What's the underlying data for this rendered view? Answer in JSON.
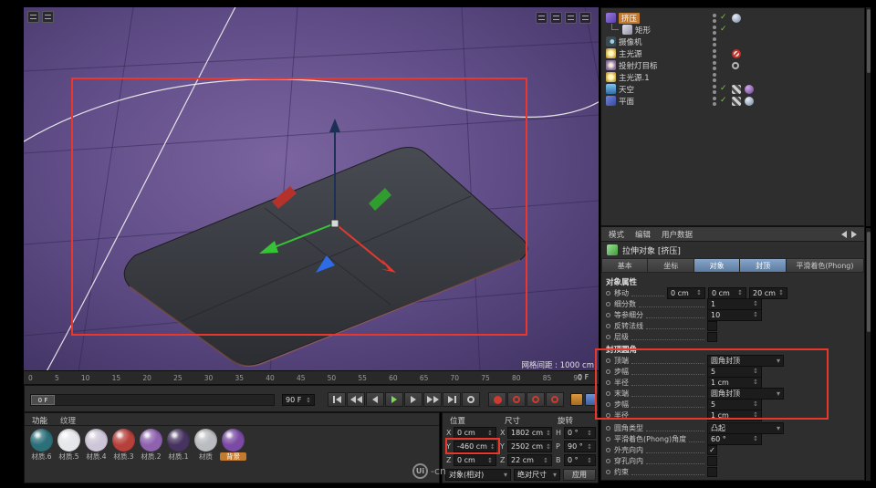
{
  "colors": {
    "annotation": "#e8372b",
    "selection_orange": "#c17a2f",
    "tab_blue": "#6b8cb0",
    "viewport_purple": "#64508a"
  },
  "viewport": {
    "grid_spacing_label": "网格间距 : 1000 cm"
  },
  "timeline": {
    "ticks": [
      "0",
      "5",
      "10",
      "15",
      "20",
      "25",
      "30",
      "35",
      "40",
      "45",
      "50",
      "55",
      "60",
      "65",
      "70",
      "75",
      "80",
      "85",
      "90"
    ],
    "range_start_handle": "0 F",
    "range_end_field": "90 F",
    "frame_indicator": "0 F"
  },
  "materials": {
    "tabs": [
      "功能",
      "纹理"
    ],
    "items": [
      {
        "name": "材质.6",
        "color": "#2b6f79"
      },
      {
        "name": "材质.5",
        "color": "#e6e7ea"
      },
      {
        "name": "材质.4",
        "color": "#cdc6d8"
      },
      {
        "name": "材质.3",
        "color": "#b8403a"
      },
      {
        "name": "材质.2",
        "color": "#8f62b0"
      },
      {
        "name": "材质.1",
        "color": "#46335f"
      },
      {
        "name": "材质",
        "color": "#b9bcc0"
      },
      {
        "name": "背景",
        "color": "#7a4aa4"
      }
    ]
  },
  "coordinates": {
    "columns": [
      "位置",
      "尺寸",
      "旋转"
    ],
    "rows": {
      "pos_x_label": "X",
      "pos_x": "0 cm",
      "pos_y_label": "Y",
      "pos_y": "-460 cm",
      "pos_z_label": "Z",
      "pos_z": "0 cm",
      "size_x_label": "X",
      "size_x": "1802 cm",
      "size_y_label": "Y",
      "size_y": "2502 cm",
      "size_z_label": "Z",
      "size_z": "22 cm",
      "rot_h_label": "H",
      "rot_h": "0 °",
      "rot_p_label": "P",
      "rot_p": "90 °",
      "rot_b_label": "B",
      "rot_b": "0 °"
    },
    "mode_dropdown": "对象(相对)",
    "size_dropdown": "绝对尺寸",
    "apply_button": "应用"
  },
  "object_manager": {
    "items": [
      {
        "name": "挤压",
        "check": "✓"
      },
      {
        "name": "矩形",
        "check": "✓"
      },
      {
        "name": "摄像机",
        "check": ""
      },
      {
        "name": "主光源",
        "check": ""
      },
      {
        "name": "投射灯目标",
        "check": ""
      },
      {
        "name": "主光源.1",
        "check": ""
      },
      {
        "name": "天空",
        "check": "✓"
      },
      {
        "name": "平面",
        "check": "✓"
      }
    ]
  },
  "attributes": {
    "menu": [
      "模式",
      "编辑",
      "用户数据"
    ],
    "title": "拉伸对象 [挤压]",
    "tabs": [
      "基本",
      "坐标",
      "对象",
      "封顶",
      "平滑着色(Phong)"
    ],
    "object_section": "对象属性",
    "rows": {
      "move_label": "移动",
      "move_x": "0 cm",
      "move_y": "0 cm",
      "move_z": "20 cm",
      "subdiv_label": "细分数",
      "subdiv": "1",
      "iso_label": "等参细分",
      "iso": "10",
      "flip_label": "反转法线",
      "flip_check": "",
      "hier_label": "层级",
      "hier_check": "",
      "caps_section": "封顶圆角",
      "start_label": "顶端",
      "start_value": "圆角封顶",
      "steps1_label": "步幅",
      "steps1": "5",
      "radius1_label": "半径",
      "radius1": "1 cm",
      "end_label": "末端",
      "end_value": "圆角封顶",
      "steps2_label": "步幅",
      "steps2": "5",
      "radius2_label": "半径",
      "radius2": "1 cm",
      "fillet_label": "圆角类型",
      "fillet_value": "凸起",
      "phong_label": "平滑着色(Phong)角度",
      "phong_value": "60 °",
      "hull_label": "外壳向内",
      "hull_check": "✓",
      "hole_label": "穿孔向内",
      "hole_check": "",
      "constrain_label": "约束",
      "constrain_check": ""
    }
  },
  "watermark": {
    "circle": "Ui",
    "text": "-cn"
  }
}
